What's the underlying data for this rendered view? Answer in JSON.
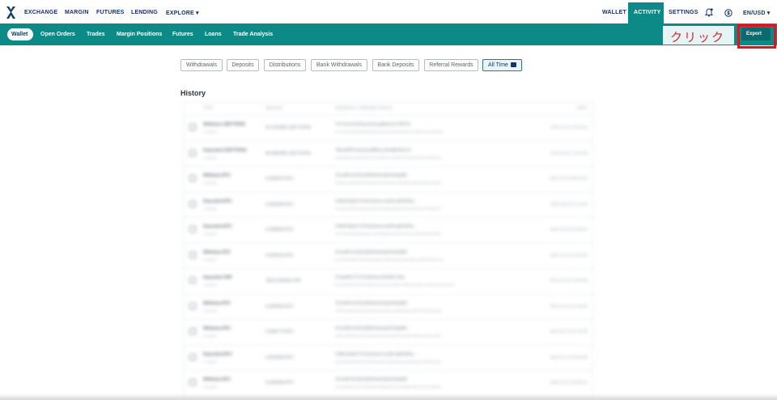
{
  "topnav": {
    "left_items": [
      "EXCHANGE",
      "MARGIN",
      "FUTURES",
      "LENDING",
      "EXPLORE ▾"
    ],
    "right_items": [
      "WALLET",
      "SETTINGS"
    ],
    "active_item": "ACTIVITY",
    "locale": "EN/USD ▾"
  },
  "subnav": {
    "tabs": [
      "Wallet",
      "Open Orders",
      "Trades",
      "Margin Positions",
      "Futures",
      "Loans",
      "Trade Analysis"
    ],
    "active_tab": "Wallet",
    "export_label": "Export"
  },
  "annotation": {
    "text": "クリック",
    "color": "#e0262f"
  },
  "filters": [
    "Withdrawals",
    "Deposits",
    "Distributions",
    "Bank Withdrawals",
    "Bank Deposits",
    "Referral Rewards",
    "All Time"
  ],
  "active_filter": "All Time",
  "history": {
    "title": "History",
    "headers": [
      "TYPE",
      "AMOUNT",
      "ADDRESS / TRANSACTION ID",
      "DATE"
    ],
    "rows": [
      {
        "type": "Withdraw USDTTRON",
        "status": "Complete",
        "amount": "99.1919280 USDTTRON",
        "addr": "TH7xmvCiCDHzrwuUsoyjMkpCyCTMFTin",
        "txid": "cd71bc8fcae0d5a20d94ba61bd6c3d71a1908c80d0e3a3f9b2c6d41d3a0b8c",
        "date": "2021-03-11 18:14:16"
      },
      {
        "type": "Deposited USDTTRON",
        "status": "Complete",
        "amount": "99.9999999 USDTTRON",
        "addr": "TBUwBPPz4ZuQzyMBDLyJNv9BKNKCz2",
        "txid": "4fd9a23b0b1cc8f5e72d01ae90c5b4e17a3b6f22c9d0e81a4b7c3e5f6a9d1e",
        "date": "2021-03-11 17:51:58"
      },
      {
        "type": "Withdraw BTC",
        "status": "Complete",
        "amount": "0.0034079 BTC",
        "addr": "1PzsMPvKz5GjYjBDRsk6c9jrbGHkgMN",
        "txid": "8a20b1c3d4e5f6a7b8c9d0e1f2a3b4c5d6e7f8a9b0c1d2e3f4a5b6c7d8e9f0",
        "date": "2021-03-02 08:53:33"
      },
      {
        "type": "Deposited BTC",
        "status": "Complete",
        "amount": "0.0500000 BTC",
        "addr": "3J98t1WpEZ73CNmQviecrnyiWrnqRhWNLy",
        "txid": "c4e2d1b0a9f8e7d6c5b4a3f2e1d0c9b8a7f6e5d4c3b2a1f0e9d8c7b6a5f4e3",
        "date": "2021-02-16 11:12:04"
      },
      {
        "type": "Deposited BTC",
        "status": "Complete",
        "amount": "0.0990000 BTC",
        "addr": "3J98t1WpEZ73CNmQviecrnyiWrnqRhWNLy",
        "txid": "f1e2d3c4b5a69788a9b0c1d2e3f4a5b6c7d8e9f0a1b2c3d4e5f6a7b8c9d0e1",
        "date": "2021-02-12 10:28:41"
      },
      {
        "type": "Withdraw BTC",
        "status": "Complete",
        "amount": "0.0004618 BTC",
        "addr": "1PzsMPvKz5GjYjBDRsk6c9jrbGHkgMN",
        "txid": "0a1b2c3d4e5f60718293a4b5c6d7e8f90a1b2c3d4e5f60718293a4b5c6d7e8",
        "date": "2021-01-21 10:33:26"
      },
      {
        "type": "Deposited XRP",
        "status": "Complete",
        "amount": "1820.2180000 XRP",
        "addr": "rPzqwMoCTFXZUhbtvAnJhEWbLTkbe",
        "txid": "E3F2A1B0C9D8E7F6A5B4C3D2E1F0A9B8C7D6E5F4A3B2C1D0E9F8A7B6C5D4",
        "date": "2021-01-20 14:00:58"
      },
      {
        "type": "Withdraw BTC",
        "status": "Complete",
        "amount": "0.0050000 BTC",
        "addr": "1PzsMPvKz5GjYjBDRsk6c9jrbGHkgMN",
        "txid": "7f6e5d4c3b2a1908f7e6d5c4b3a29180f7e6d5c4b3a2918070f6e5d4c3b2a1",
        "date": "2021-01-21 07:53:05"
      },
      {
        "type": "Withdraw BTC",
        "status": "Complete",
        "amount": "0.0082770 BTC",
        "addr": "1PzsMPvKz5GjYjBDRsk6c9jrbGHkgMN",
        "txid": "9e8d7c6b5a4f3e2d1c0b9a8f7e6d5c4b3a2f1e0d9c8b7a6f5e4d3c2b1a0f9e",
        "date": "2021-01-21 07:20:39"
      },
      {
        "type": "Deposited BTC",
        "status": "Complete",
        "amount": "0.0529050 BTC",
        "addr": "3J98t1WpEZ73CNmQviecrnyiWrnqRhWNLy",
        "txid": "2b3c4d5e6f7a8b9c0d1e2f3a4b5c6d7e8f9a0b1c2d3e4f5a6b7c8d9e0f1a2b",
        "date": "2021-01-14 19:43:25"
      },
      {
        "type": "Withdraw BTC",
        "status": "Complete",
        "amount": "0.0030950 BTC",
        "addr": "1PzsMPvKz5GjYjBDRsk6c9jrbGHkgMN",
        "txid": "5c6d7e8f9a0b1c2d3e4f5a6b7c8d9e0f1a2b3c4d5e6f7a8b9c0d1e2f3a4b5c",
        "date": "2020-12-16 18:29:01"
      }
    ]
  }
}
